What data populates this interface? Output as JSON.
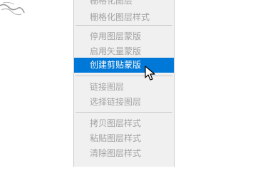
{
  "menu": {
    "items": [
      {
        "label": "栅格化图层",
        "state": "disabled"
      },
      {
        "label": "栅格化图层样式",
        "state": "disabled"
      },
      {
        "label": "停用图层蒙版",
        "state": "disabled"
      },
      {
        "label": "启用矢量蒙版",
        "state": "disabled"
      },
      {
        "label": "创建剪贴蒙版",
        "state": "highlighted"
      },
      {
        "label": "链接图层",
        "state": "disabled"
      },
      {
        "label": "选择链接图层",
        "state": "disabled"
      },
      {
        "label": "拷贝图层样式",
        "state": "disabled"
      },
      {
        "label": "粘贴图层样式",
        "state": "disabled"
      },
      {
        "label": "清除图层样式",
        "state": "disabled"
      }
    ]
  },
  "colors": {
    "menu_bg": "#f0f0f0",
    "highlight_bg": "#0078d7",
    "disabled_text": "#a3a3a3",
    "separator": "#c8c8c8"
  },
  "cursor": {
    "icon": "arrow-pointer-icon"
  }
}
